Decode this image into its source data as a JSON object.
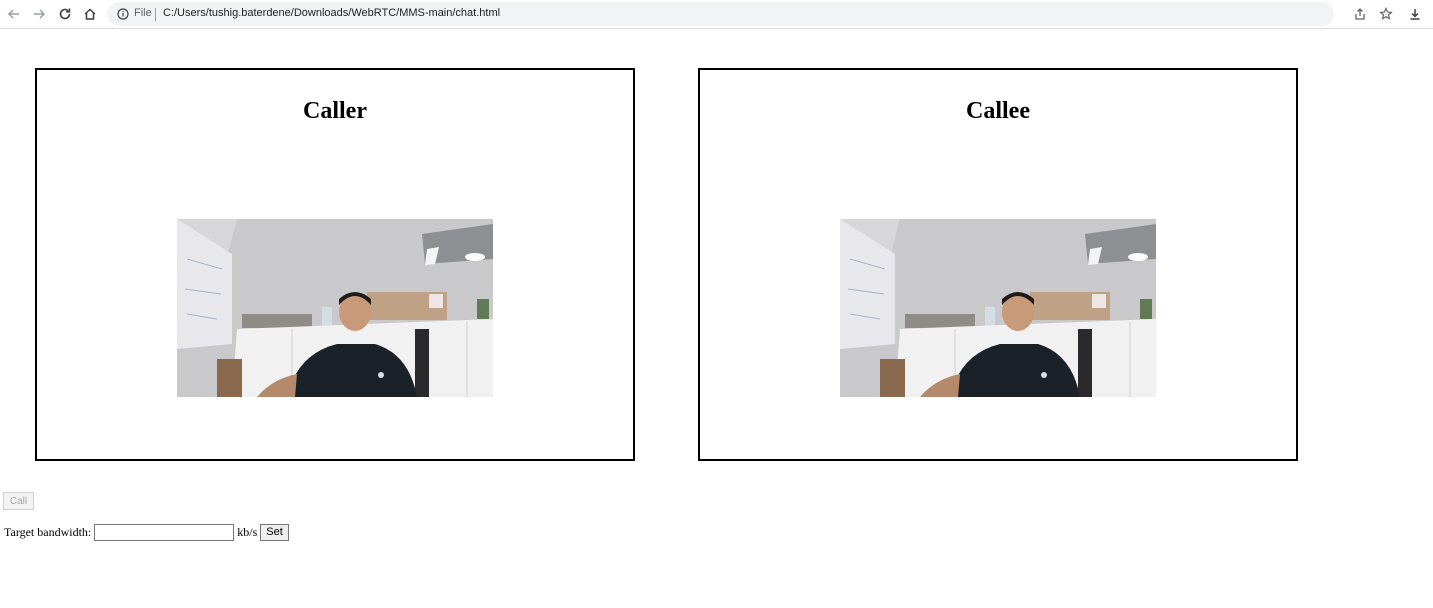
{
  "browser": {
    "scheme_label": "File",
    "url": "C:/Users/tushig.baterdene/Downloads/WebRTC/MMS-main/chat.html",
    "icons": [
      "back-icon",
      "forward-icon",
      "reload-icon",
      "home-icon",
      "info-icon",
      "share-icon",
      "star-icon",
      "download-icon"
    ]
  },
  "panels": [
    {
      "title": "Caller"
    },
    {
      "title": "Callee"
    }
  ],
  "controls": {
    "call_label": "Call",
    "call_disabled": true,
    "bandwidth_label": "Target bandwidth:",
    "bandwidth_value": "",
    "bandwidth_unit": "kb/s",
    "set_label": "Set"
  },
  "colors": {
    "panel_border": "#000000",
    "toolbar_bg": "#ffffff",
    "address_bg": "#f1f3f4"
  }
}
